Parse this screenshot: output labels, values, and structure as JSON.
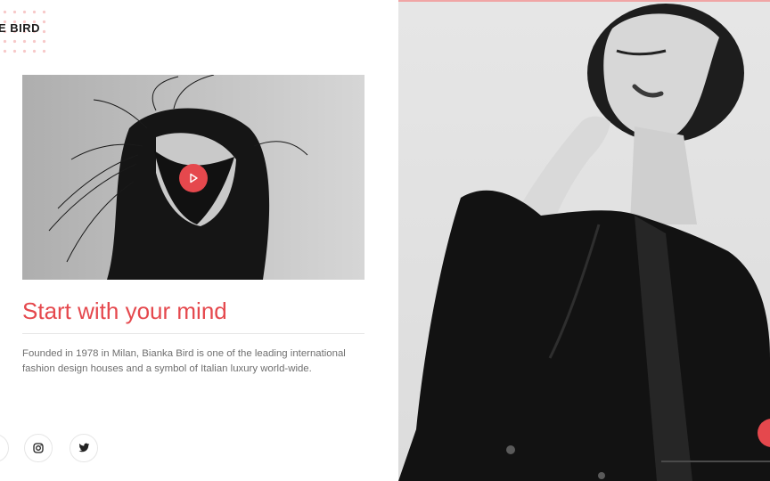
{
  "brand": {
    "name": "E BIRD"
  },
  "hero": {
    "headline": "Start with your mind",
    "description": "Founded in 1978 in Milan, Bianka Bird is one of the leading international fashion design houses and a symbol of Italian luxury world-wide.",
    "video": {
      "play_icon": "play-icon"
    }
  },
  "social": [
    {
      "name": "facebook",
      "icon": "facebook-icon"
    },
    {
      "name": "instagram",
      "icon": "instagram-icon"
    },
    {
      "name": "twitter",
      "icon": "twitter-icon"
    }
  ],
  "colors": {
    "accent": "#e5484d",
    "text": "#1c1c1c",
    "muted": "#6f6f6f"
  }
}
